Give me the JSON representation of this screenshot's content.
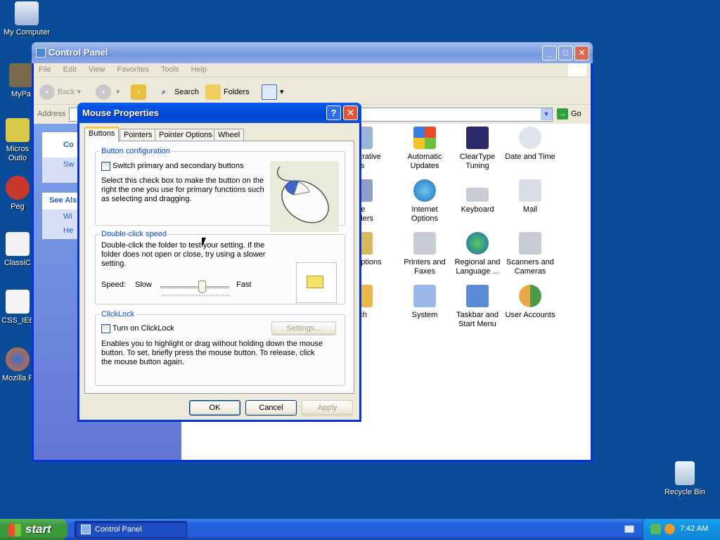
{
  "desktop_icons": [
    {
      "label": "My Computer"
    },
    {
      "label": "MyPa"
    },
    {
      "label": "Micros Outlo"
    },
    {
      "label": "Peg"
    },
    {
      "label": "ClassiC"
    },
    {
      "label": "CSS_IE6"
    },
    {
      "label": "Mozilla F"
    },
    {
      "label": "Recycle Bin"
    }
  ],
  "control_panel": {
    "title": "Control Panel",
    "menu": [
      "File",
      "Edit",
      "View",
      "Favorites",
      "Tools",
      "Help"
    ],
    "toolbar": {
      "back": "Back",
      "search": "Search",
      "folders": "Folders"
    },
    "address_label": "Address",
    "go_label": "Go",
    "left_pane": {
      "panel_title": "Co",
      "switch_item": "Sw",
      "see_also": "See Als",
      "see_also_items": [
        "Wi",
        "He"
      ]
    },
    "items": [
      {
        "label": "nistrative\nools",
        "icon": "admin-tools-icon"
      },
      {
        "label": "Automatic\nUpdates",
        "icon": "automatic-updates-icon"
      },
      {
        "label": "ClearType\nTuning",
        "icon": "cleartype-icon"
      },
      {
        "label": "Date and Time",
        "icon": "date-time-icon"
      },
      {
        "label": "ame\ntrollers",
        "icon": "game-controllers-icon"
      },
      {
        "label": "Internet\nOptions",
        "icon": "internet-options-icon"
      },
      {
        "label": "Keyboard",
        "icon": "keyboard-icon"
      },
      {
        "label": "Mail",
        "icon": "mail-icon"
      },
      {
        "label": "r Options",
        "icon": "power-options-icon"
      },
      {
        "label": "Printers and\nFaxes",
        "icon": "printers-icon"
      },
      {
        "label": "Regional and\nLanguage ...",
        "icon": "regional-icon"
      },
      {
        "label": "Scanners and\nCameras",
        "icon": "scanners-icon"
      },
      {
        "label": "eech",
        "icon": "speech-icon"
      },
      {
        "label": "System",
        "icon": "system-icon"
      },
      {
        "label": "Taskbar and\nStart Menu",
        "icon": "taskbar-icon"
      },
      {
        "label": "User Accounts",
        "icon": "user-accounts-icon"
      }
    ]
  },
  "dialog": {
    "title": "Mouse Properties",
    "tabs": [
      "Buttons",
      "Pointers",
      "Pointer Options",
      "Wheel"
    ],
    "button_config": {
      "legend": "Button configuration",
      "checkbox_label": "Switch primary and secondary buttons",
      "checked": false,
      "description": "Select this check box to make the button on the right the one you use for primary functions such as selecting and dragging."
    },
    "double_click": {
      "legend": "Double-click speed",
      "description": "Double-click the folder to test your setting. If the folder does not open or close, try using a slower setting.",
      "speed_label": "Speed:",
      "slow_label": "Slow",
      "fast_label": "Fast",
      "slider_value": 0.6
    },
    "clicklock": {
      "legend": "ClickLock",
      "checkbox_label": "Turn on ClickLock",
      "checked": false,
      "settings_button": "Settings...",
      "description": "Enables you to highlight or drag without holding down the mouse button. To set, briefly press the mouse button. To release, click the mouse button again."
    },
    "buttons": {
      "ok": "OK",
      "cancel": "Cancel",
      "apply": "Apply"
    }
  },
  "taskbar": {
    "start_label": "start",
    "tasks": [
      {
        "label": "Control Panel"
      }
    ],
    "clock": "7:42 AM"
  }
}
